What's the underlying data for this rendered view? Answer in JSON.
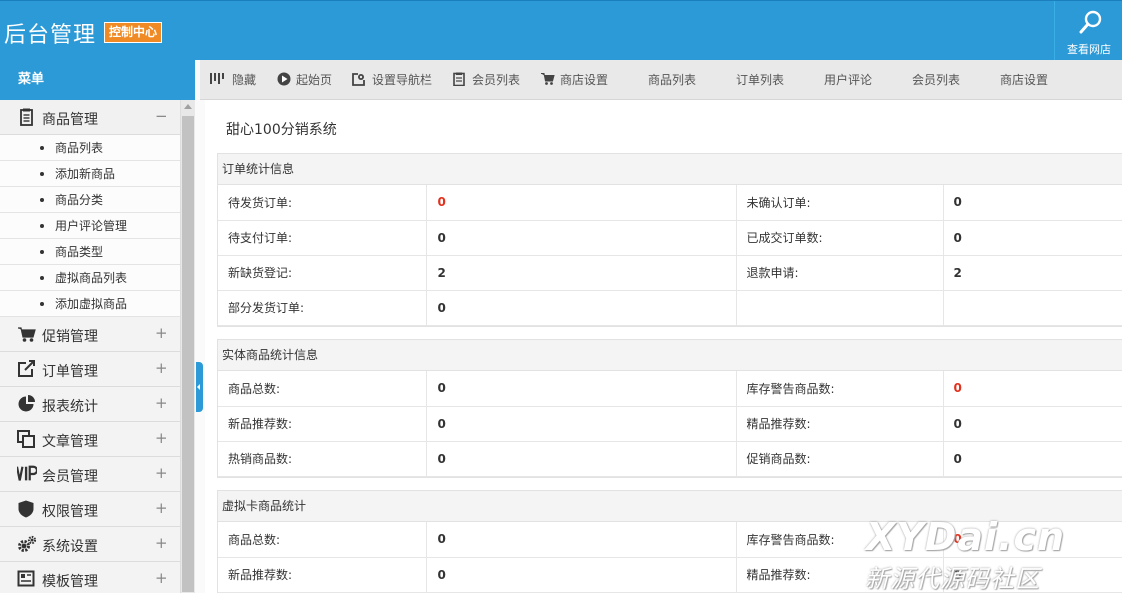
{
  "header": {
    "brand": "后台管理",
    "badge": "控制中心",
    "site_link": "查看网店"
  },
  "sidebar": {
    "title": "菜单",
    "groups": [
      {
        "label": "商品管理",
        "icon": "clipboard-icon",
        "toggle": "−",
        "items": [
          "商品列表",
          "添加新商品",
          "商品分类",
          "用户评论管理",
          "商品类型",
          "虚拟商品列表",
          "添加虚拟商品"
        ]
      },
      {
        "label": "促销管理",
        "icon": "cart-icon",
        "toggle": "+"
      },
      {
        "label": "订单管理",
        "icon": "external-link-icon",
        "toggle": "+"
      },
      {
        "label": "报表统计",
        "icon": "pie-chart-icon",
        "toggle": "+"
      },
      {
        "label": "文章管理",
        "icon": "copy-icon",
        "toggle": "+"
      },
      {
        "label": "会员管理",
        "icon": "vip-icon",
        "toggle": "+"
      },
      {
        "label": "权限管理",
        "icon": "shield-icon",
        "toggle": "+"
      },
      {
        "label": "系统设置",
        "icon": "gears-icon",
        "toggle": "+"
      },
      {
        "label": "模板管理",
        "icon": "template-icon",
        "toggle": "+"
      }
    ]
  },
  "toolbar": {
    "items": [
      "隐藏",
      "起始页",
      "设置导航栏",
      "会员列表",
      "商店设置",
      "商品列表",
      "订单列表",
      "用户评论",
      "会员列表",
      "商店设置"
    ]
  },
  "main": {
    "title": "甜心100分销系统",
    "sections": [
      {
        "title": "订单统计信息",
        "rows": [
          [
            "待发货订单:",
            "0",
            "未确认订单:",
            "0"
          ],
          [
            "待支付订单:",
            "0",
            "已成交订单数:",
            "0"
          ],
          [
            "新缺货登记:",
            "2",
            "退款申请:",
            "2"
          ],
          [
            "部分发货订单:",
            "0",
            "",
            ""
          ]
        ]
      },
      {
        "title": "实体商品统计信息",
        "rows": [
          [
            "商品总数:",
            "0",
            "库存警告商品数:",
            "0"
          ],
          [
            "新品推荐数:",
            "0",
            "精品推荐数:",
            "0"
          ],
          [
            "热销商品数:",
            "0",
            "促销商品数:",
            "0"
          ]
        ]
      },
      {
        "title": "虚拟卡商品统计",
        "rows": [
          [
            "商品总数:",
            "0",
            "库存警告商品数:",
            "0"
          ],
          [
            "新品推荐数:",
            "0",
            "精品推荐数:",
            "0"
          ]
        ]
      }
    ]
  },
  "watermark": {
    "line1": "XYDai.cn",
    "line2": "新源代源码社区"
  },
  "colors": {
    "primary": "#2b9ad7",
    "badge": "#f08a24",
    "alert": "#e0321e"
  }
}
